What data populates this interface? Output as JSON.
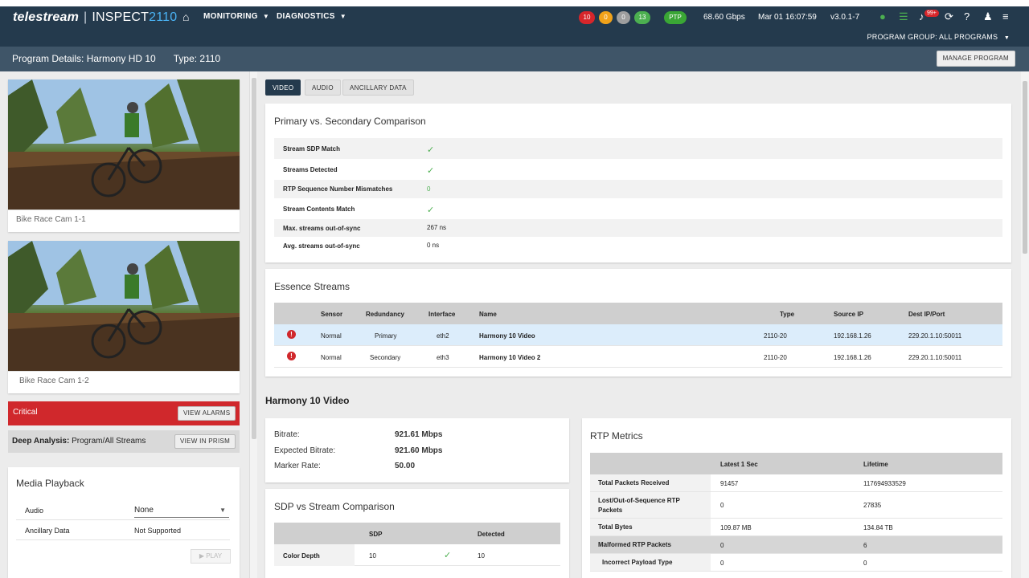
{
  "nav": {
    "brand_tel": "telestream",
    "brand_separator": "|",
    "brand_inspect": "INSPECT",
    "brand_num": "2110",
    "monitoring": "MONITORING",
    "diagnostics": "DIAGNOSTICS",
    "pills": [
      {
        "label": "10",
        "color": "#d7262b"
      },
      {
        "label": "0",
        "color": "#f0a21a"
      },
      {
        "label": "0",
        "color": "#9e9e9e"
      },
      {
        "label": "13",
        "color": "#4caf50"
      }
    ],
    "ptp": "PTP",
    "bandwidth": "68.60 Gbps",
    "datetime": "Mar 01 16:07:59",
    "version": "v3.0.1-7",
    "notifications": "99+",
    "program_group": "PROGRAM GROUP: ALL PROGRAMS"
  },
  "header": {
    "title": "Program Details: Harmony HD 10",
    "type": "Type: 2110",
    "manage": "MANAGE PROGRAM"
  },
  "left": {
    "cams": [
      {
        "label": "Bike Race Cam 1-1"
      },
      {
        "label": "Bike Race Cam 1-2"
      }
    ],
    "critical": "Critical",
    "view_alarms": "VIEW ALARMS",
    "deep_label": "Deep Analysis:",
    "deep_value": "Program/All Streams",
    "view_prism": "VIEW IN PRISM",
    "media": {
      "title": "Media Playback",
      "audio_label": "Audio",
      "audio_value": "None",
      "anc_label": "Ancillary Data",
      "anc_value": "Not Supported",
      "play": "PLAY"
    }
  },
  "tabs": [
    "VIDEO",
    "AUDIO",
    "ANCILLARY DATA"
  ],
  "comparison": {
    "title": "Primary vs. Secondary Comparison",
    "rows": [
      {
        "label": "Stream SDP Match",
        "value": "✓",
        "kind": "check"
      },
      {
        "label": "Streams Detected",
        "value": "✓",
        "kind": "check"
      },
      {
        "label": "RTP Sequence Number Mismatches",
        "value": "0",
        "kind": "green"
      },
      {
        "label": "Stream Contents Match",
        "value": "✓",
        "kind": "check"
      },
      {
        "label": "Max. streams out-of-sync",
        "value": "267 ns",
        "kind": "text"
      },
      {
        "label": "Avg. streams out-of-sync",
        "value": "0 ns",
        "kind": "text"
      }
    ]
  },
  "essence": {
    "title": "Essence Streams",
    "headers": [
      "Sensor",
      "Redundancy",
      "Interface",
      "Name",
      "Type",
      "Source IP",
      "Dest IP/Port"
    ],
    "rows": [
      {
        "sensor": "Normal",
        "redundancy": "Primary",
        "interface": "eth2",
        "name": "Harmony 10 Video",
        "type": "2110-20",
        "source": "192.168.1.26",
        "dest": "229.20.1.10:50011"
      },
      {
        "sensor": "Normal",
        "redundancy": "Secondary",
        "interface": "eth3",
        "name": "Harmony 10 Video 2",
        "type": "2110-20",
        "source": "192.168.1.26",
        "dest": "229.20.1.10:50011"
      }
    ]
  },
  "video": {
    "title": "Harmony 10 Video",
    "bitrate_label": "Bitrate:",
    "bitrate": "921.61 Mbps",
    "expected_label": "Expected Bitrate:",
    "expected": "921.60 Mbps",
    "marker_label": "Marker Rate:",
    "marker": "50.00"
  },
  "sdp": {
    "title": "SDP vs Stream Comparison",
    "col_sdp": "SDP",
    "col_detected": "Detected",
    "row_label": "Color Depth",
    "row_sdp": "10",
    "row_check": "✓",
    "row_detected": "10"
  },
  "rtp": {
    "title": "RTP Metrics",
    "col_latest": "Latest 1 Sec",
    "col_lifetime": "Lifetime",
    "rows": [
      {
        "label": "Total Packets Received",
        "latest": "91457",
        "lifetime": "117694933529"
      },
      {
        "label": "Lost/Out-of-Sequence RTP Packets",
        "latest": "0",
        "lifetime": "27835"
      },
      {
        "label": "Total Bytes",
        "latest": "109.87 MB",
        "lifetime": "134.84 TB"
      },
      {
        "label": "Malformed RTP Packets",
        "latest": "0",
        "lifetime": "6"
      },
      {
        "label": "Incorrect Payload Type",
        "latest": "0",
        "lifetime": "0"
      }
    ]
  }
}
